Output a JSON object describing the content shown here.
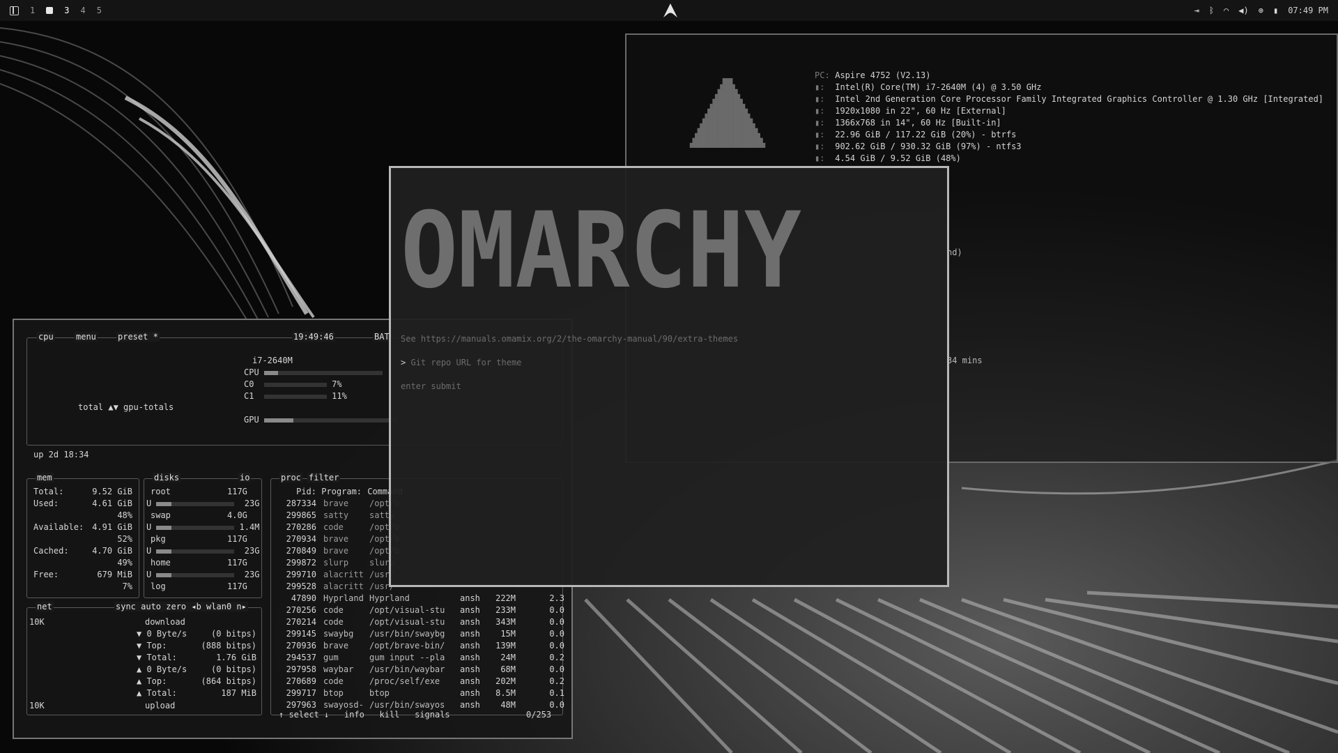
{
  "topbar": {
    "workspaces": [
      "1",
      "3",
      "4",
      "5"
    ],
    "clock": "07:49 PM",
    "tray_icons": [
      "logout-icon",
      "bluetooth-icon",
      "wifi-icon",
      "volume-icon",
      "network-icon",
      "battery-icon"
    ]
  },
  "fastfetch": {
    "rows": [
      {
        "key": "PC:",
        "value": "Aspire 4752 (V2.13)"
      },
      {
        "key": "",
        "value": "Intel(R) Core(TM) i7-2640M (4) @ 3.50 GHz"
      },
      {
        "key": "",
        "value": "Intel 2nd Generation Core Processor Family Integrated Graphics Controller @ 1.30 GHz [Integrated]"
      },
      {
        "key": "",
        "value": "1920x1080 in 22\", 60 Hz [External]"
      },
      {
        "key": "",
        "value": "1366x768 in 14\", 60 Hz [Built-in]"
      },
      {
        "key": "",
        "value": "22.96 GiB / 117.22 GiB (20%) - btrfs"
      },
      {
        "key": "",
        "value": "902.62 GiB / 930.32 GiB (97%) - ntfs3"
      },
      {
        "key": "",
        "value": "4.54 GiB / 9.52 GiB (48%)"
      }
    ],
    "partial_1": "nd)",
    "partial_2": "34 mins"
  },
  "btop": {
    "header": {
      "cpu": "cpu",
      "menu": "menu",
      "preset": "preset *",
      "time": "19:49:46",
      "bat": "BAT"
    },
    "cpu_model": "i7-2640M",
    "cpu_rows": [
      {
        "label": "CPU",
        "pct": ""
      },
      {
        "label": "C0",
        "pct": "7%"
      },
      {
        "label": "C1",
        "pct": "11%"
      }
    ],
    "gpu_label": "GPU",
    "totals": "total ▲▼ gpu-totals",
    "uptime": "up 2d 18:34",
    "mem": {
      "title": "mem",
      "rows": [
        {
          "k": "Total:",
          "v": "9.52 GiB"
        },
        {
          "k": "Used:",
          "v": "4.61 GiB"
        },
        {
          "k": "",
          "v": "48%"
        },
        {
          "k": "Available:",
          "v": "4.91 GiB"
        },
        {
          "k": "",
          "v": "52%"
        },
        {
          "k": "Cached:",
          "v": "4.70 GiB"
        },
        {
          "k": "",
          "v": "49%"
        },
        {
          "k": "Free:",
          "v": "679 MiB"
        },
        {
          "k": "",
          "v": "7%"
        }
      ]
    },
    "disks": {
      "title": "disks",
      "io": "io",
      "rows": [
        {
          "name": "root",
          "size": "117G",
          "used": "23G"
        },
        {
          "name": "swap",
          "size": "4.0G",
          "used": "1.4M"
        },
        {
          "name": "pkg",
          "size": "117G",
          "used": "23G"
        },
        {
          "name": "home",
          "size": "117G",
          "used": "23G"
        },
        {
          "name": "log",
          "size": "117G",
          "used": ""
        }
      ]
    },
    "net": {
      "title": "net",
      "controls": "sync  auto  zero  ◂b  wlan0  n▸",
      "scale_top": "10K",
      "scale_bottom": "10K",
      "download": "download",
      "upload": "upload",
      "rows": [
        {
          "k": "▼ 0 Byte/s",
          "v": "(0 bitps)"
        },
        {
          "k": "▼ Top:",
          "v": "(888 bitps)"
        },
        {
          "k": "▼ Total:",
          "v": "1.76 GiB"
        },
        {
          "k": "▲ 0 Byte/s",
          "v": "(0 bitps)"
        },
        {
          "k": "▲ Top:",
          "v": "(864 bitps)"
        },
        {
          "k": "▲ Total:",
          "v": "187 MiB"
        }
      ]
    },
    "proc": {
      "title": "proc",
      "filter": "filter",
      "headers": [
        "Pid:",
        "Program:",
        "Command"
      ],
      "rows": [
        {
          "pid": "287334",
          "prog": "brave",
          "cmd": "/opt/b",
          "user": "",
          "mem": "",
          "cpu": ""
        },
        {
          "pid": "299865",
          "prog": "satty",
          "cmd": "satty",
          "user": "",
          "mem": "",
          "cpu": ""
        },
        {
          "pid": "270286",
          "prog": "code",
          "cmd": "/opt/v",
          "user": "",
          "mem": "",
          "cpu": ""
        },
        {
          "pid": "270934",
          "prog": "brave",
          "cmd": "/opt/b",
          "user": "",
          "mem": "",
          "cpu": ""
        },
        {
          "pid": "270849",
          "prog": "brave",
          "cmd": "/opt/b",
          "user": "",
          "mem": "",
          "cpu": ""
        },
        {
          "pid": "299872",
          "prog": "slurp",
          "cmd": "slurp",
          "user": "",
          "mem": "",
          "cpu": ""
        },
        {
          "pid": "299710",
          "prog": "alacritt",
          "cmd": "/usr/",
          "user": "",
          "mem": "",
          "cpu": ""
        },
        {
          "pid": "299528",
          "prog": "alacritt",
          "cmd": "/usr/",
          "user": "",
          "mem": "",
          "cpu": ""
        },
        {
          "pid": "47890",
          "prog": "Hyprland",
          "cmd": "Hyprland",
          "user": "ansh",
          "mem": "222M",
          "cpu": "2.3"
        },
        {
          "pid": "270256",
          "prog": "code",
          "cmd": "/opt/visual-stu",
          "user": "ansh",
          "mem": "233M",
          "cpu": "0.0"
        },
        {
          "pid": "270214",
          "prog": "code",
          "cmd": "/opt/visual-stu",
          "user": "ansh",
          "mem": "343M",
          "cpu": "0.0"
        },
        {
          "pid": "299145",
          "prog": "swaybg",
          "cmd": "/usr/bin/swaybg",
          "user": "ansh",
          "mem": "15M",
          "cpu": "0.0"
        },
        {
          "pid": "270936",
          "prog": "brave",
          "cmd": "/opt/brave-bin/",
          "user": "ansh",
          "mem": "139M",
          "cpu": "0.0"
        },
        {
          "pid": "294537",
          "prog": "gum",
          "cmd": "gum input --pla",
          "user": "ansh",
          "mem": "24M",
          "cpu": "0.2"
        },
        {
          "pid": "297958",
          "prog": "waybar",
          "cmd": "/usr/bin/waybar",
          "user": "ansh",
          "mem": "68M",
          "cpu": "0.0"
        },
        {
          "pid": "270689",
          "prog": "code",
          "cmd": "/proc/self/exe",
          "user": "ansh",
          "mem": "202M",
          "cpu": "0.2"
        },
        {
          "pid": "299717",
          "prog": "btop",
          "cmd": "btop",
          "user": "ansh",
          "mem": "8.5M",
          "cpu": "0.1"
        },
        {
          "pid": "297963",
          "prog": "swayosd-",
          "cmd": "/usr/bin/swayos",
          "user": "ansh",
          "mem": "48M",
          "cpu": "0.0"
        }
      ],
      "footer": "↑ select ↓   info   kill   signals",
      "count": "0/253"
    }
  },
  "prompt": {
    "title": "OMARCHY",
    "hint": "See https://manuals.omamix.org/2/the-omarchy-manual/90/extra-themes",
    "input_caret": ">",
    "placeholder": "Git repo URL for theme",
    "footer": "enter submit"
  }
}
